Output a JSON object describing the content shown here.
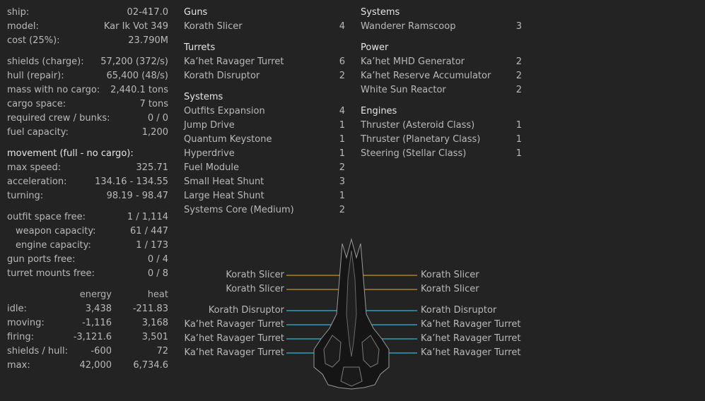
{
  "stats": {
    "ship_label": "ship:",
    "ship_value": "02-417.0",
    "model_label": "model:",
    "model_value": "Kar Ik Vot 349",
    "cost_label": "cost (25%):",
    "cost_value": "23.790M",
    "shields_label": "shields (charge):",
    "shields_value": "57,200 (372/s)",
    "hull_label": "hull (repair):",
    "hull_value": "65,400 (48/s)",
    "mass_label": "mass with no cargo:",
    "mass_value": "2,440.1 tons",
    "cargo_label": "cargo space:",
    "cargo_value": "7 tons",
    "crew_label": "required crew / bunks:",
    "crew_value": "0 / 0",
    "fuel_label": "fuel capacity:",
    "fuel_value": "1,200",
    "movement_header": "movement (full - no cargo):",
    "speed_label": "max speed:",
    "speed_value": "325.71",
    "accel_label": "acceleration:",
    "accel_value": "134.16 - 134.55",
    "turning_label": "turning:",
    "turning_value": "98.19 - 98.47",
    "outfit_label": "outfit space free:",
    "outfit_value": "1 / 1,114",
    "weapon_label": "weapon capacity:",
    "weapon_value": "61 / 447",
    "engine_label": "engine capacity:",
    "engine_value": "1 / 173",
    "gunports_label": "gun ports free:",
    "gunports_value": "0 / 4",
    "turretmounts_label": "turret mounts free:",
    "turretmounts_value": "0 / 8"
  },
  "energy_table": {
    "energy_header": "energy",
    "heat_header": "heat",
    "rows": [
      {
        "label": "idle:",
        "energy": "3,438",
        "heat": "-211.83"
      },
      {
        "label": "moving:",
        "energy": "-1,116",
        "heat": "3,168"
      },
      {
        "label": "firing:",
        "energy": "-3,121.6",
        "heat": "3,501"
      },
      {
        "label": "shields / hull:",
        "energy": "-600",
        "heat": "72"
      },
      {
        "label": "max:",
        "energy": "42,000",
        "heat": "6,734.6"
      }
    ]
  },
  "outfits_mid": {
    "guns_header": "Guns",
    "guns": [
      {
        "name": "Korath Slicer",
        "count": "4"
      }
    ],
    "turrets_header": "Turrets",
    "turrets": [
      {
        "name": "Ka’het Ravager Turret",
        "count": "6"
      },
      {
        "name": "Korath Disruptor",
        "count": "2"
      }
    ],
    "systems_header": "Systems",
    "systems": [
      {
        "name": "Outfits Expansion",
        "count": "4"
      },
      {
        "name": "Jump Drive",
        "count": "1"
      },
      {
        "name": "Quantum Keystone",
        "count": "1"
      },
      {
        "name": "Hyperdrive",
        "count": "1"
      },
      {
        "name": "Fuel Module",
        "count": "2"
      },
      {
        "name": "Small Heat Shunt",
        "count": "3"
      },
      {
        "name": "Large Heat Shunt",
        "count": "1"
      },
      {
        "name": "Systems Core (Medium)",
        "count": "2"
      }
    ]
  },
  "outfits_right": {
    "systems_header": "Systems",
    "systems": [
      {
        "name": "Wanderer Ramscoop",
        "count": "3"
      }
    ],
    "power_header": "Power",
    "power": [
      {
        "name": "Ka’het MHD Generator",
        "count": "2"
      },
      {
        "name": "Ka’het Reserve Accumulator",
        "count": "2"
      },
      {
        "name": "White Sun Reactor",
        "count": "2"
      }
    ],
    "engines_header": "Engines",
    "engines": [
      {
        "name": "Thruster (Asteroid Class)",
        "count": "1"
      },
      {
        "name": "Thruster (Planetary Class)",
        "count": "1"
      },
      {
        "name": "Steering (Stellar Class)",
        "count": "1"
      }
    ]
  },
  "hardpoints": {
    "left": [
      "Korath Slicer",
      "Korath Slicer",
      "Korath Disruptor",
      "Ka’het Ravager Turret",
      "Ka’het Ravager Turret",
      "Ka’het Ravager Turret"
    ],
    "right": [
      "Korath Slicer",
      "Korath Slicer",
      "Korath Disruptor",
      "Ka’het Ravager Turret",
      "Ka’het Ravager Turret",
      "Ka’het Ravager Turret"
    ],
    "gun_color": "#8a6a1e",
    "turret_color": "#2b7f93"
  },
  "ship_icon": "ship-sprite-icon"
}
